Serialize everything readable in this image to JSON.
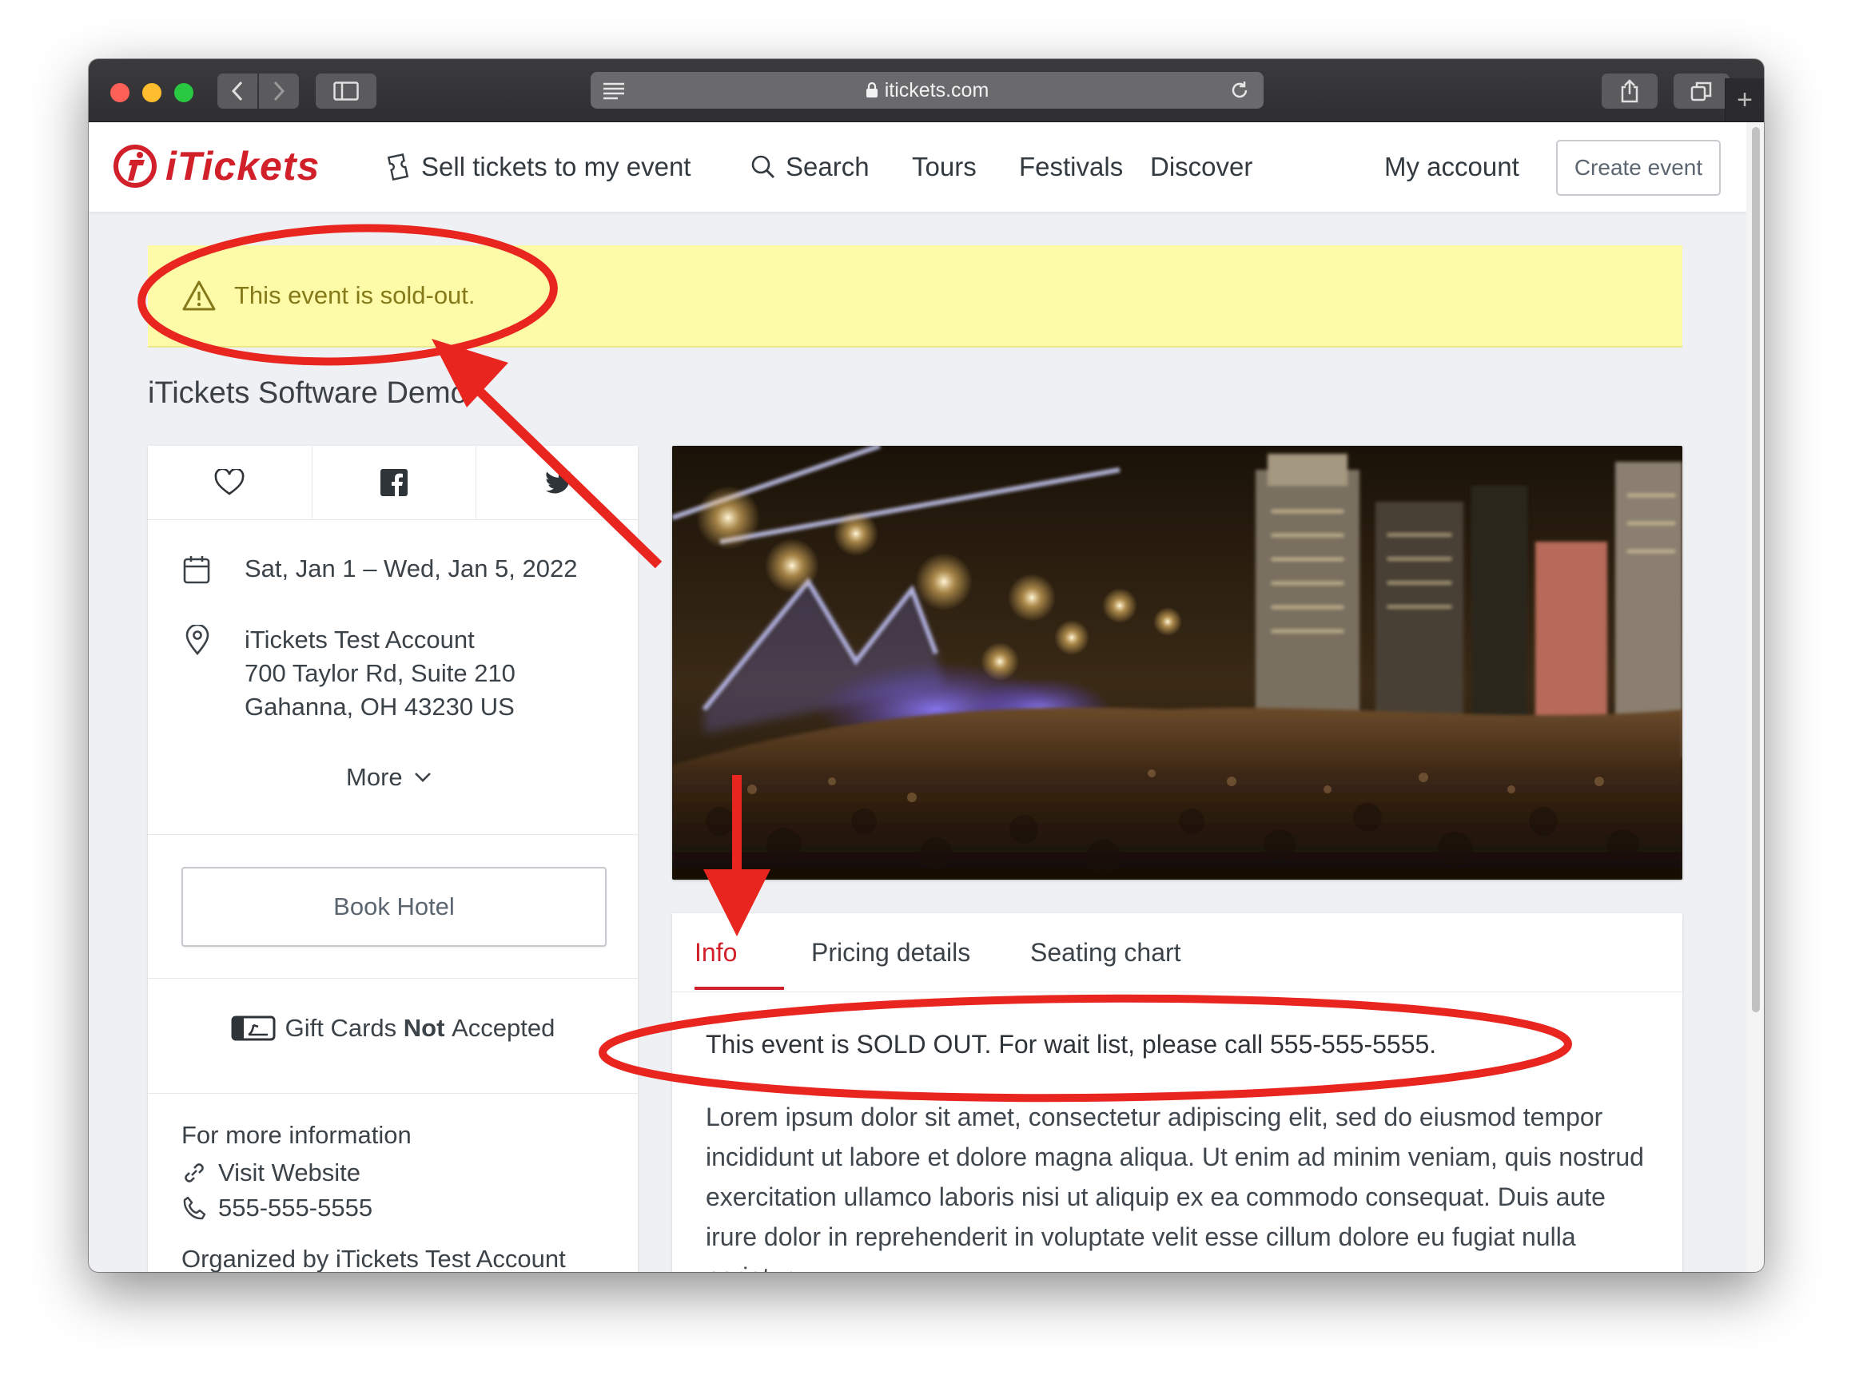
{
  "browser": {
    "url": "itickets.com"
  },
  "nav": {
    "logo_text": "iTickets",
    "sell": "Sell tickets to my event",
    "search": "Search",
    "tours": "Tours",
    "festivals": "Festivals",
    "discover": "Discover",
    "my_account": "My account",
    "create_event": "Create event"
  },
  "banner": {
    "text": "This event is sold-out."
  },
  "event": {
    "title": "iTickets Software Demo"
  },
  "sidebar": {
    "date": "Sat, Jan 1 – Wed, Jan 5, 2022",
    "venue_name": "iTickets Test Account",
    "address_line1": "700 Taylor Rd, Suite 210",
    "address_line2": "Gahanna, OH 43230 US",
    "more": "More",
    "book_hotel": "Book Hotel",
    "gift_prefix": "Gift Cards",
    "gift_bold": "Not",
    "gift_suffix": "Accepted",
    "more_info": "For more information",
    "website": "Visit Website",
    "phone": "555-555-5555",
    "organizer_partial": "Organized by iTickets Test Account"
  },
  "tabs": [
    {
      "label": "Info",
      "active": true
    },
    {
      "label": "Pricing details",
      "active": false
    },
    {
      "label": "Seating chart",
      "active": false
    }
  ],
  "content": {
    "soldout_note": "This event is SOLD OUT. For wait list, please call 555-555-5555.",
    "lorem": "Lorem ipsum dolor sit amet, consectetur adipiscing elit, sed do eiusmod tempor incididunt ut labore et dolore magna aliqua. Ut enim ad minim veniam, quis nostrud exercitation ullamco laboris nisi ut aliquip ex ea commodo consequat. Duis aute irure dolor in reprehenderit in voluptate velit esse cillum dolore eu fugiat nulla pariatur."
  },
  "colors": {
    "brand_red": "#d2202b",
    "banner_bg": "#fdfaa8",
    "banner_text": "#857a1a",
    "annotation_red": "#e8261f"
  }
}
